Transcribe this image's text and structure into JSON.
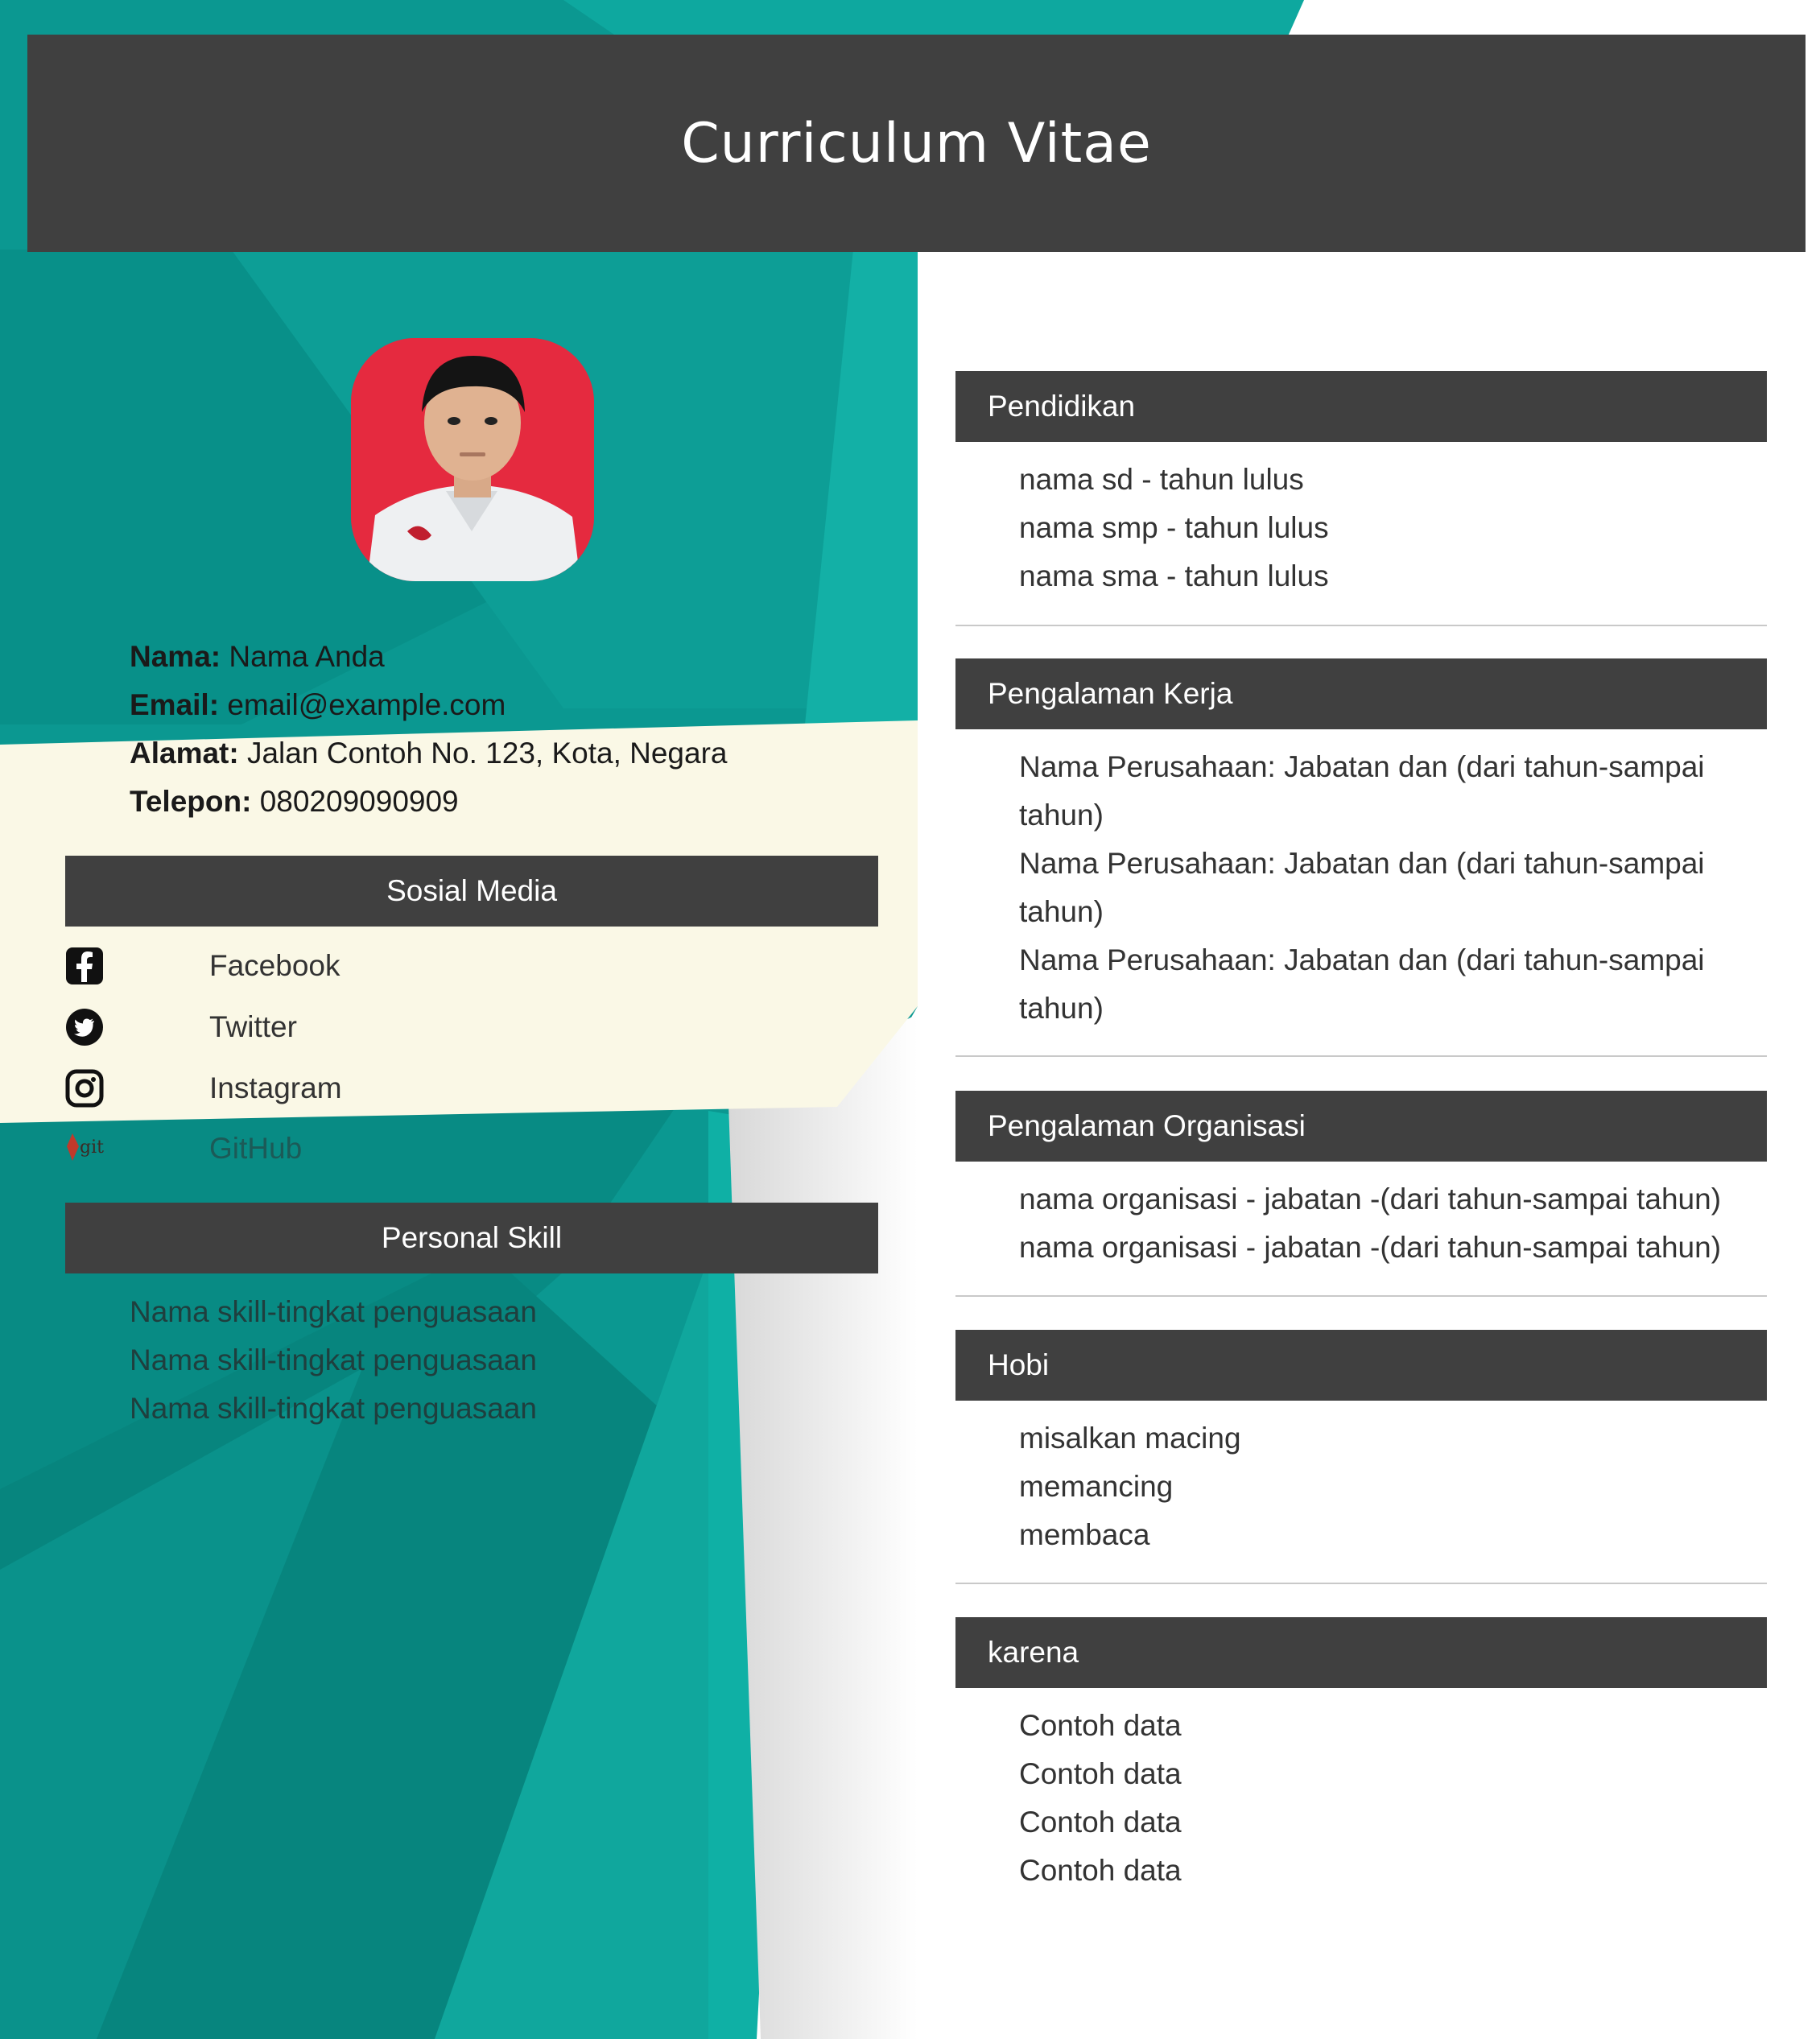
{
  "header": {
    "title": "Curriculum Vitae"
  },
  "profile": {
    "photo_icon": "profile-photo",
    "fields": [
      {
        "label": "Nama:",
        "value": "Nama Anda"
      },
      {
        "label": "Email:",
        "value": "email@example.com"
      },
      {
        "label": "Alamat:",
        "value": "Jalan Contoh No. 123, Kota, Negara"
      },
      {
        "label": "Telepon:",
        "value": "080209090909"
      }
    ]
  },
  "social": {
    "title": "Sosial Media",
    "items": [
      {
        "label": "Facebook",
        "icon": "facebook-icon"
      },
      {
        "label": "Twitter",
        "icon": "twitter-icon"
      },
      {
        "label": "Instagram",
        "icon": "instagram-icon"
      },
      {
        "label": "GitHub",
        "icon": "git-icon"
      }
    ]
  },
  "skills": {
    "title": "Personal Skill",
    "items": [
      "Nama skill-tingkat penguasaan",
      "Nama skill-tingkat penguasaan",
      "Nama skill-tingkat penguasaan"
    ]
  },
  "sections": [
    {
      "title": "Pendidikan",
      "items": [
        "nama sd - tahun lulus",
        "nama smp - tahun lulus",
        "nama sma - tahun lulus"
      ]
    },
    {
      "title": "Pengalaman Kerja",
      "items": [
        "Nama Perusahaan: Jabatan dan (dari tahun-sampai",
        "tahun)",
        "Nama Perusahaan: Jabatan dan (dari tahun-sampai",
        "tahun)",
        "Nama Perusahaan: Jabatan dan (dari tahun-sampai",
        "tahun)"
      ]
    },
    {
      "title": "Pengalaman Organisasi",
      "items": [
        "nama organisasi - jabatan -(dari tahun-sampai tahun)",
        "nama organisasi - jabatan -(dari tahun-sampai tahun)"
      ]
    },
    {
      "title": "Hobi",
      "items": [
        "misalkan macing",
        "memancing",
        "membaca"
      ]
    },
    {
      "title": "karena",
      "items": [
        "Contoh data",
        "Contoh data",
        "Contoh data",
        "Contoh data"
      ]
    }
  ],
  "colors": {
    "teal": "#0a9a92",
    "dark_bar": "#404040",
    "cream": "#faf8e6"
  }
}
